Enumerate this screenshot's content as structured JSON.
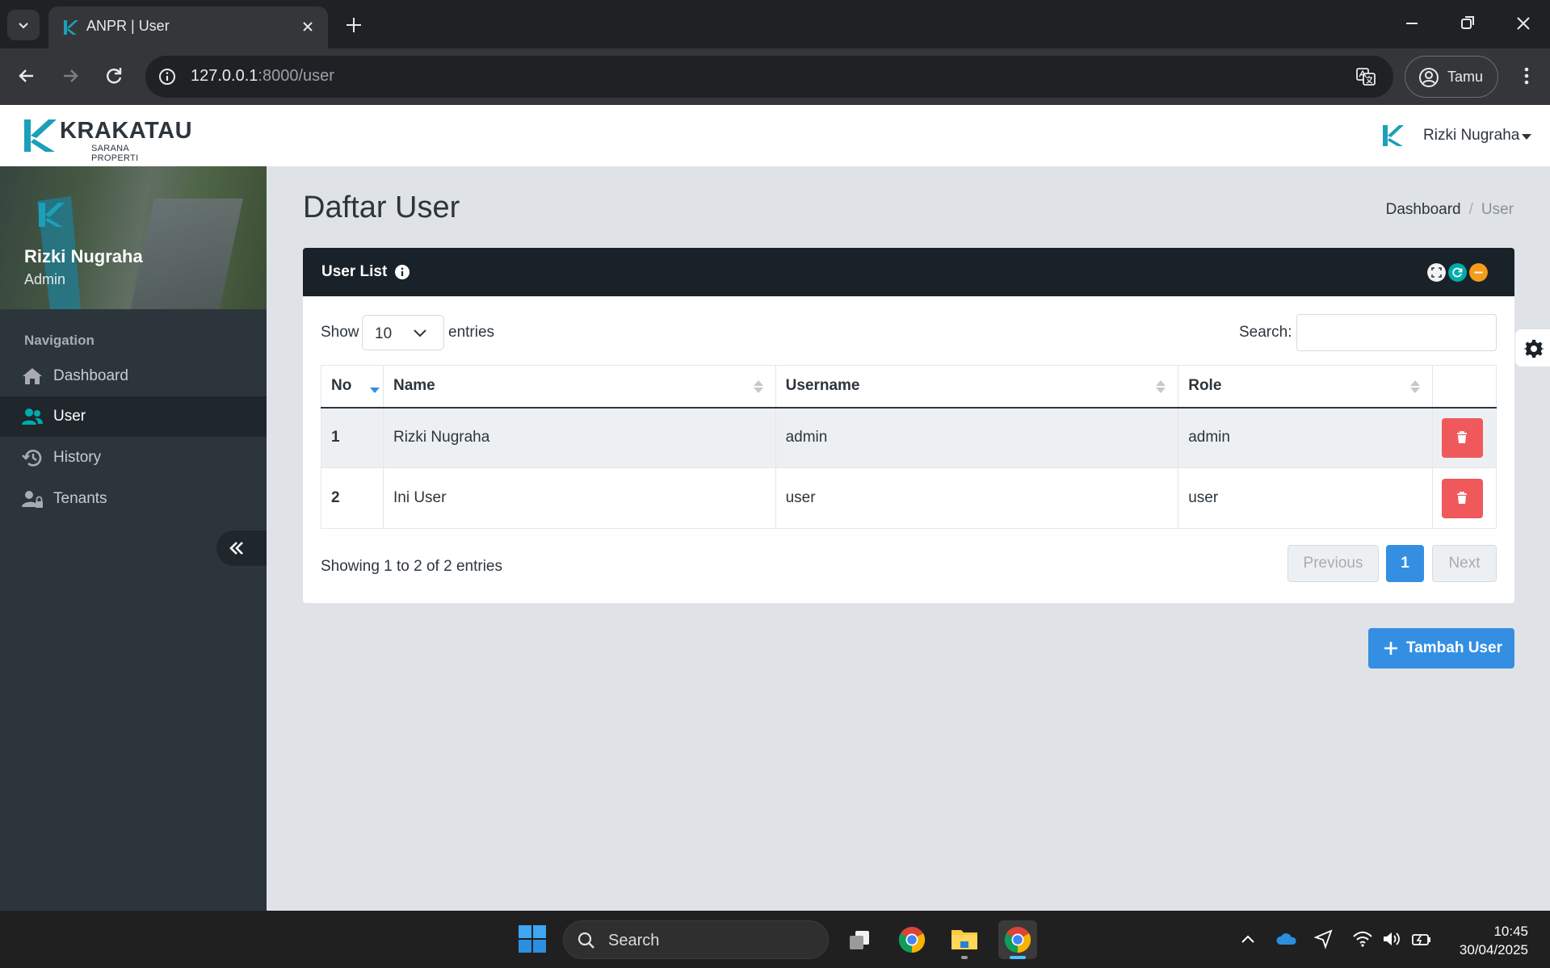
{
  "browser": {
    "tab_title": "ANPR | User",
    "url_host": "127.0.0.1",
    "url_rest": ":8000/user",
    "profile_label": "Tamu"
  },
  "header": {
    "logo_word": "KRAKATAU",
    "logo_sub": "SARANA PROPERTI",
    "user_name": "Rizki Nugraha"
  },
  "sidebar": {
    "profile_name": "Rizki Nugraha",
    "profile_role": "Admin",
    "nav_heading": "Navigation",
    "items": [
      {
        "label": "Dashboard",
        "icon": "home-icon"
      },
      {
        "label": "User",
        "icon": "users-icon",
        "active": true
      },
      {
        "label": "History",
        "icon": "history-icon"
      },
      {
        "label": "Tenants",
        "icon": "user-lock-icon"
      }
    ]
  },
  "page": {
    "title": "Daftar User",
    "breadcrumb": [
      "Dashboard",
      "User"
    ]
  },
  "panel": {
    "title": "User List",
    "show_label": "Show",
    "page_length": "10",
    "entries_label": "entries",
    "search_label": "Search:",
    "search_value": "",
    "columns": [
      "No",
      "Name",
      "Username",
      "Role"
    ],
    "rows": [
      {
        "no": "1",
        "name": "Rizki Nugraha",
        "username": "admin",
        "role": "admin"
      },
      {
        "no": "2",
        "name": "Ini User",
        "username": "user",
        "role": "user"
      }
    ],
    "info": "Showing 1 to 2 of 2 entries",
    "pagination": {
      "previous": "Previous",
      "current": "1",
      "next": "Next"
    }
  },
  "add_button_label": "Tambah User",
  "taskbar": {
    "search_label": "Search",
    "time": "10:45",
    "date": "30/04/2025"
  },
  "colors": {
    "primary": "#348fe2",
    "danger": "#f0595b",
    "teal": "#00acac",
    "warning": "#f59c1a",
    "sidebar_bg": "#2d353c",
    "panel_head": "#1a2229"
  }
}
